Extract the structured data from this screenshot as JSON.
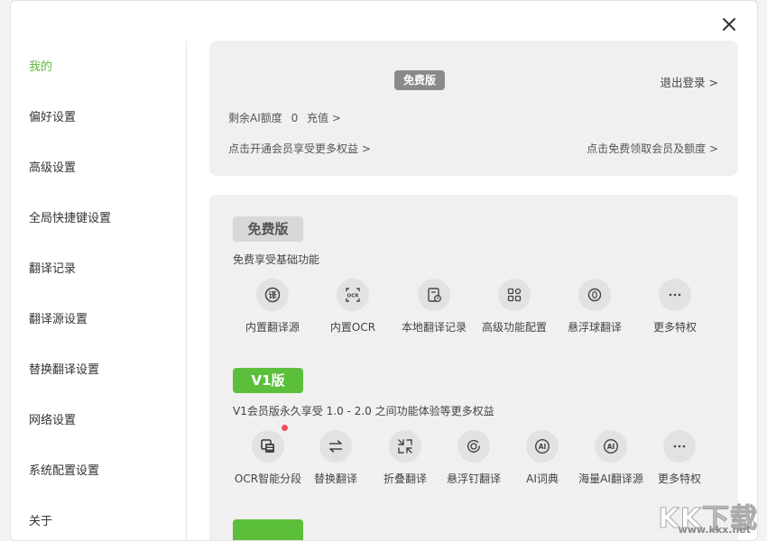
{
  "sidebar": {
    "items": [
      {
        "label": "我的"
      },
      {
        "label": "偏好设置"
      },
      {
        "label": "高级设置"
      },
      {
        "label": "全局快捷键设置"
      },
      {
        "label": "翻译记录"
      },
      {
        "label": "翻译源设置"
      },
      {
        "label": "替换翻译设置"
      },
      {
        "label": "网络设置"
      },
      {
        "label": "系统配置设置"
      },
      {
        "label": "关于"
      }
    ],
    "active_color": "#5cb83a"
  },
  "account": {
    "plan_badge": "免费版",
    "logout": "退出登录 >",
    "quota_label": "剩余AI额度",
    "quota_value": "0",
    "recharge": "充值 >",
    "member_link": "点击开通会员享受更多权益 >",
    "free_link": "点击免费领取会员及额度 >"
  },
  "free_plan": {
    "badge": "免费版",
    "desc": "免费享受基础功能",
    "features": [
      {
        "label": "内置翻译源",
        "icon": "translate-icon"
      },
      {
        "label": "内置OCR",
        "icon": "ocr-icon"
      },
      {
        "label": "本地翻译记录",
        "icon": "history-icon"
      },
      {
        "label": "高级功能配置",
        "icon": "grid-icon"
      },
      {
        "label": "悬浮球翻译",
        "icon": "float-ball-icon"
      },
      {
        "label": "更多特权",
        "icon": "more-icon"
      }
    ]
  },
  "v1_plan": {
    "badge": "V1版",
    "desc": "V1会员版永久享受 1.0 - 2.0 之间功能体验等更多权益",
    "features": [
      {
        "label": "OCR智能分段",
        "icon": "ocr-segment-icon"
      },
      {
        "label": "替换翻译",
        "icon": "swap-icon"
      },
      {
        "label": "折叠翻译",
        "icon": "collapse-icon"
      },
      {
        "label": "悬浮钉翻译",
        "icon": "pin-icon"
      },
      {
        "label": "AI词典",
        "icon": "ai-icon"
      },
      {
        "label": "海量AI翻译源",
        "icon": "ai-source-icon"
      },
      {
        "label": "更多特权",
        "icon": "more-icon"
      }
    ]
  },
  "watermark": {
    "text": "KK下载",
    "url": "www.kkx.net"
  },
  "colors": {
    "accent": "#5cbf3c",
    "badge_gray": "#8a8a8a",
    "card_bg": "#f0f0f0",
    "notify_dot": "#f0505a"
  }
}
